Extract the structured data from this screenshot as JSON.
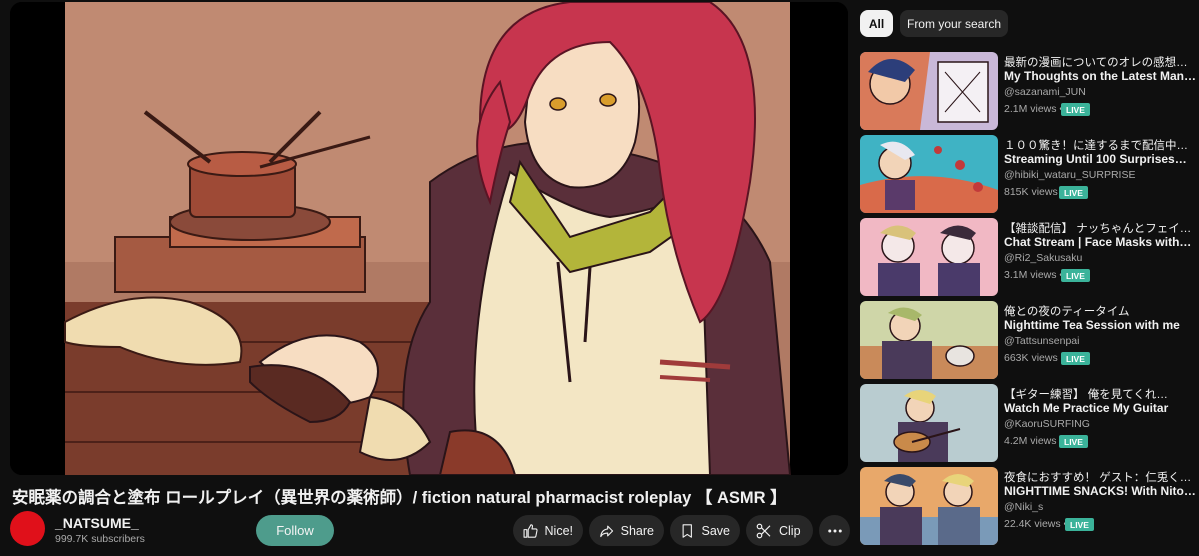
{
  "video": {
    "title": "安眠薬の調合と塗布 ロールプレイ（異世界の薬術師）/ fiction natural pharmacist roleplay 【 ASMR 】"
  },
  "channel": {
    "name": "_NATSUME_",
    "subscribers": "999.7K subscribers",
    "follow_label": "Follow",
    "avatar_color": "#e0101a"
  },
  "actions": {
    "nice": "Nice!",
    "share": "Share",
    "save": "Save",
    "clip": "Clip",
    "more_icon": "more-horizontal-icon"
  },
  "filters": {
    "all": "All",
    "from_search": "From your search"
  },
  "recommendations": [
    {
      "title_jp": "最新の漫画についてのオレの感想、『…",
      "title_en": "My Thoughts on the Latest Manga…",
      "channel": "@sazanami_JUN",
      "views": "2.1M views",
      "badge": "LIVE"
    },
    {
      "title_jp": "１００驚き！に達するまで配信中…",
      "title_en": "Streaming Until 100 Surprises…",
      "channel": "@hibiki_wataru_SURPRISE",
      "views": "815K views",
      "badge": "LIVE"
    },
    {
      "title_jp": "【雑談配信】 ナッちゃんとフェイ…",
      "title_en": "Chat Stream | Face Masks with…",
      "channel": "@Ri2_Sakusaku",
      "views": "3.1M views",
      "badge": "LIVE"
    },
    {
      "title_jp": "俺との夜のティータイム",
      "title_en": "Nighttime Tea Session with me",
      "channel": "@Tattsunsenpai",
      "views": "663K views",
      "badge": "LIVE"
    },
    {
      "title_jp": "【ギター練習】 俺を見てくれ…",
      "title_en": "Watch Me Practice My Guitar",
      "channel": "@KaoruSURFING",
      "views": "4.2M views",
      "badge": "LIVE"
    },
    {
      "title_jp": "夜食におすすめ！ ゲスト：仁兎く…",
      "title_en": "NIGHTTIME SNACKS! With Nito…",
      "channel": "@Niki_s",
      "views": "22.4K views",
      "badge": "LIVE"
    }
  ],
  "colors": {
    "background": "#0f0f0f",
    "follow_button": "#4e9c8c",
    "live_badge": "#3bb39a",
    "pill": "#272727"
  }
}
